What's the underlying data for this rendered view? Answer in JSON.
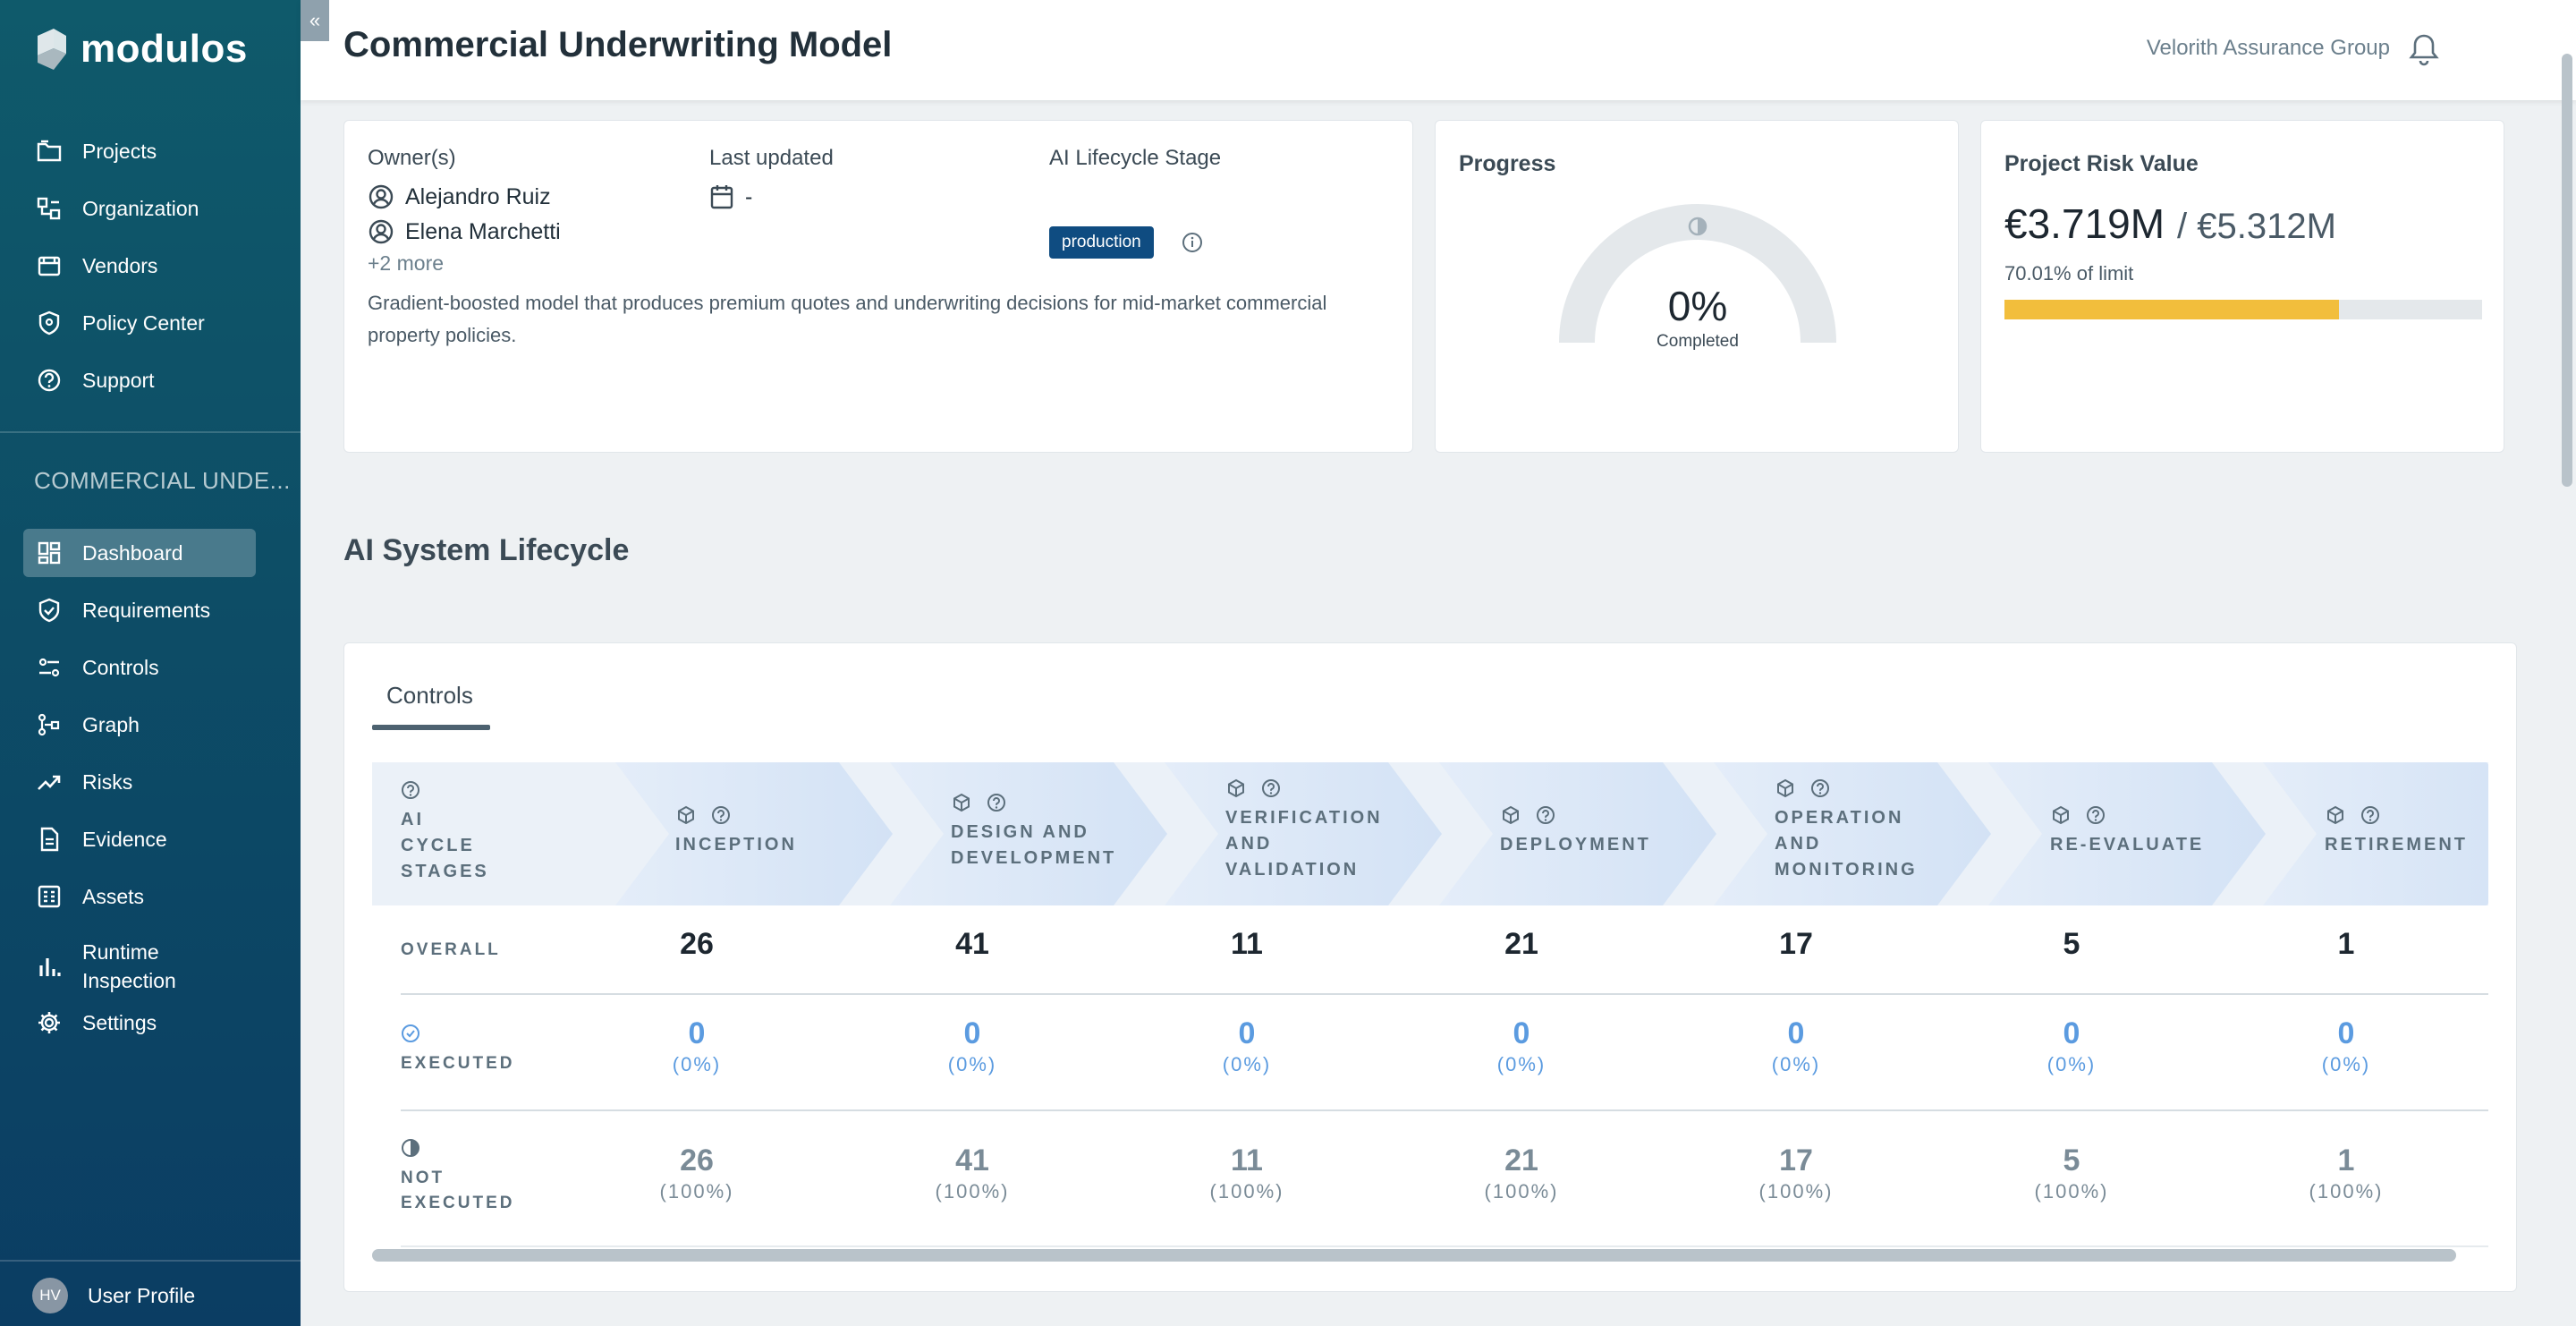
{
  "brand": {
    "name": "modulos"
  },
  "sidebar": {
    "main_items": [
      {
        "label": "Projects",
        "icon": "folder-icon"
      },
      {
        "label": "Organization",
        "icon": "organization-icon"
      },
      {
        "label": "Vendors",
        "icon": "vendors-icon"
      },
      {
        "label": "Policy Center",
        "icon": "shield-icon"
      },
      {
        "label": "Support",
        "icon": "help-icon"
      }
    ],
    "section_label": "COMMERCIAL UNDE...",
    "project_items": [
      {
        "label": "Dashboard",
        "icon": "dashboard-icon",
        "active": true
      },
      {
        "label": "Requirements",
        "icon": "shield-check-icon"
      },
      {
        "label": "Controls",
        "icon": "controls-icon"
      },
      {
        "label": "Graph",
        "icon": "graph-icon"
      },
      {
        "label": "Risks",
        "icon": "trend-icon"
      },
      {
        "label": "Evidence",
        "icon": "document-icon"
      },
      {
        "label": "Assets",
        "icon": "assets-icon"
      },
      {
        "label": "Runtime Inspection",
        "icon": "bar-chart-icon"
      },
      {
        "label": "Settings",
        "icon": "gear-icon"
      }
    ],
    "profile": {
      "initials": "HV",
      "label": "User Profile"
    }
  },
  "header": {
    "title": "Commercial Underwriting Model",
    "organization": "Velorith Assurance Group"
  },
  "overview": {
    "owners_label": "Owner(s)",
    "owners": [
      "Alejandro Ruiz",
      "Elena Marchetti"
    ],
    "more": "+2 more",
    "last_updated_label": "Last updated",
    "last_updated_value": "-",
    "lifecycle_label": "AI Lifecycle Stage",
    "lifecycle_value": "production",
    "description": "Gradient-boosted model that produces premium quotes and underwriting decisions for mid-market commercial property policies."
  },
  "progress": {
    "title": "Progress",
    "value": "0%",
    "caption": "Completed",
    "fraction": 0
  },
  "risk": {
    "title": "Project Risk Value",
    "value": "€3.719M",
    "limit": "/ €5.312M",
    "caption": "70.01% of limit",
    "fraction": 0.7001,
    "bar_color": "#f2be3c"
  },
  "lifecycle": {
    "title": "AI System Lifecycle",
    "tab": "Controls",
    "header_label": [
      "AI",
      "CYCLE",
      "STAGES"
    ],
    "stages": [
      {
        "lines": [
          "INCEPTION"
        ],
        "overall": "26",
        "executed": "0",
        "executed_pct": "(0%)",
        "not_executed": "26",
        "not_executed_pct": "(100%)"
      },
      {
        "lines": [
          "DESIGN AND",
          "DEVELOPMENT"
        ],
        "overall": "41",
        "executed": "0",
        "executed_pct": "(0%)",
        "not_executed": "41",
        "not_executed_pct": "(100%)"
      },
      {
        "lines": [
          "VERIFICATION",
          "AND",
          "VALIDATION"
        ],
        "overall": "11",
        "executed": "0",
        "executed_pct": "(0%)",
        "not_executed": "11",
        "not_executed_pct": "(100%)"
      },
      {
        "lines": [
          "DEPLOYMENT"
        ],
        "overall": "21",
        "executed": "0",
        "executed_pct": "(0%)",
        "not_executed": "21",
        "not_executed_pct": "(100%)"
      },
      {
        "lines": [
          "OPERATION",
          "AND",
          "MONITORING"
        ],
        "overall": "17",
        "executed": "0",
        "executed_pct": "(0%)",
        "not_executed": "17",
        "not_executed_pct": "(100%)"
      },
      {
        "lines": [
          "RE-EVALUATE"
        ],
        "overall": "5",
        "executed": "0",
        "executed_pct": "(0%)",
        "not_executed": "5",
        "not_executed_pct": "(100%)"
      },
      {
        "lines": [
          "RETIREMENT"
        ],
        "overall": "1",
        "executed": "0",
        "executed_pct": "(0%)",
        "not_executed": "1",
        "not_executed_pct": "(100%)"
      }
    ],
    "row_labels": {
      "overall": "OVERALL",
      "executed": "EXECUTED",
      "not_executed": [
        "NOT",
        "EXECUTED"
      ]
    }
  }
}
